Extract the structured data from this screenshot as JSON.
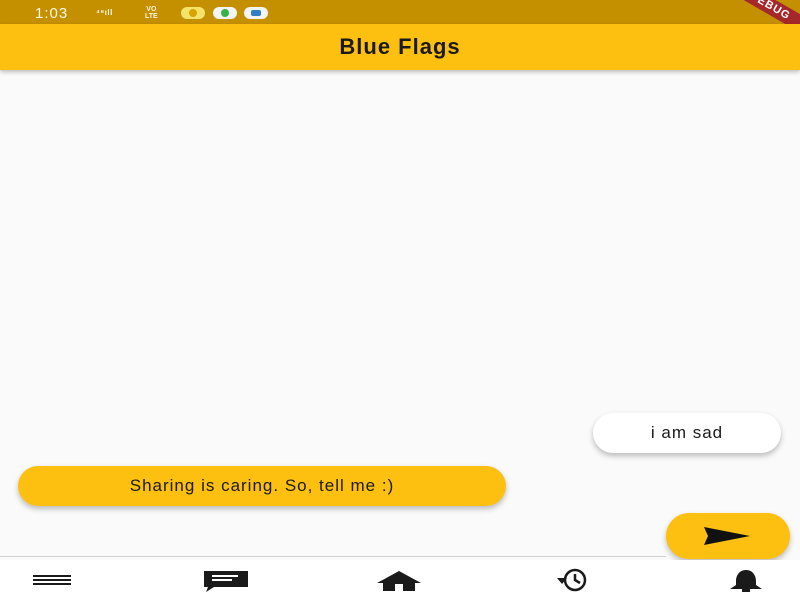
{
  "status_bar": {
    "time": "1:03",
    "signal": "⁴⁶ıll",
    "volte": "VO\nLTE"
  },
  "debug_banner": "DEBUG",
  "app_bar": {
    "title": "Blue Flags"
  },
  "chat": {
    "messages": [
      {
        "sender": "user",
        "text": "i am sad"
      },
      {
        "sender": "bot",
        "text": "Sharing is caring. So, tell me :)"
      }
    ]
  },
  "bottom_nav": {
    "items": [
      "menu-icon",
      "chat-icon",
      "home-icon",
      "history-icon",
      "bell-icon"
    ]
  },
  "colors": {
    "primary": "#fdc010",
    "status_bar": "#c49000",
    "background": "#fafafa",
    "debug": "#a5282a"
  }
}
